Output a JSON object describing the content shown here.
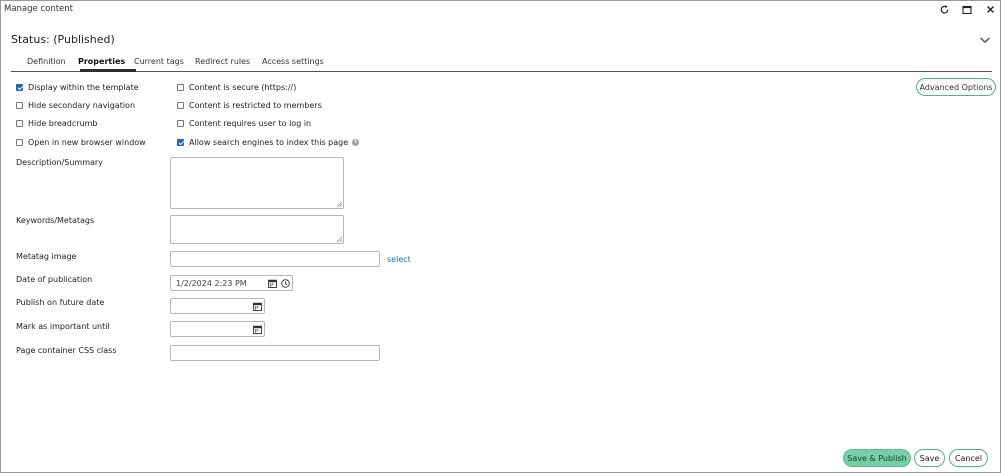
{
  "window": {
    "title": "Manage content"
  },
  "status": {
    "title": "Status: (Published)"
  },
  "tabs": [
    {
      "label": "Definition",
      "active": false
    },
    {
      "label": "Properties",
      "active": true
    },
    {
      "label": "Current tags",
      "active": false
    },
    {
      "label": "Redirect rules",
      "active": false
    },
    {
      "label": "Access settings",
      "active": false
    }
  ],
  "advanced_options": {
    "label": "Advanced Options"
  },
  "options": {
    "left": [
      {
        "label": "Display within the template",
        "checked": true
      },
      {
        "label": "Hide secondary navigation",
        "checked": false
      },
      {
        "label": "Hide breadcrumb",
        "checked": false
      },
      {
        "label": "Open in new browser window",
        "checked": false
      }
    ],
    "right": [
      {
        "label": "Content is secure (https://)",
        "checked": false
      },
      {
        "label": "Content is restricted to members",
        "checked": false
      },
      {
        "label": "Content requires user to log in",
        "checked": false
      },
      {
        "label": "Allow search engines to index this page",
        "checked": true
      }
    ]
  },
  "fields": {
    "description": {
      "label": "Description/Summary",
      "value": ""
    },
    "keywords": {
      "label": "Keywords/Metatags",
      "value": ""
    },
    "metatag_image": {
      "label": "Metatag image",
      "value": "",
      "link": "select"
    },
    "date_of_publication": {
      "label": "Date of publication",
      "value": "1/2/2024 2:23 PM"
    },
    "publish_future": {
      "label": "Publish on future date",
      "value": ""
    },
    "mark_important": {
      "label": "Mark as important until",
      "value": ""
    },
    "css_class": {
      "label": "Page container CSS class",
      "value": ""
    }
  },
  "footer": {
    "save_publish": "Save & Publish",
    "save": "Save",
    "cancel": "Cancel"
  },
  "colors": {
    "accent": "#56b28e",
    "primary_button": "#77cfa8",
    "checkbox_checked": "#1b64c8",
    "link": "#1a6fb5"
  },
  "icons": {
    "refresh": "refresh-icon",
    "maximize": "maximize-icon",
    "close": "close-icon",
    "collapse": "chevron-down-icon",
    "calendar": "calendar-icon",
    "clock": "clock-icon",
    "info": "info-icon"
  }
}
